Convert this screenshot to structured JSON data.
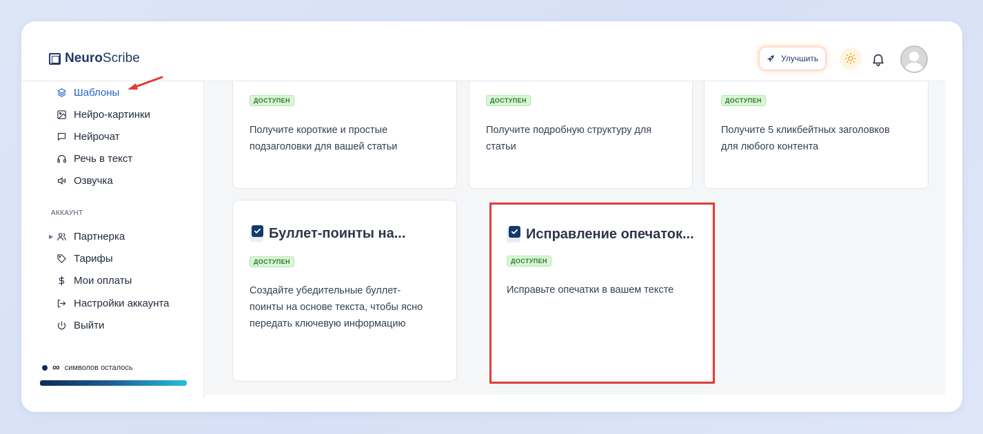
{
  "app": {
    "logo_bold": "Neuro",
    "logo_rest": "Scribe",
    "upgrade_label": "Улучшить"
  },
  "sidebar": {
    "items": [
      {
        "label": "Шаблоны",
        "icon": "layers-icon"
      },
      {
        "label": "Нейро-картинки",
        "icon": "image-icon"
      },
      {
        "label": "Нейрочат",
        "icon": "chat-icon"
      },
      {
        "label": "Речь в текст",
        "icon": "headphones-icon"
      },
      {
        "label": "Озвучка",
        "icon": "speaker-icon"
      }
    ],
    "section_label": "АККАУНТ",
    "account_items": [
      {
        "label": "Партнерка",
        "icon": "users-icon"
      },
      {
        "label": "Тарифы",
        "icon": "tag-icon"
      },
      {
        "label": "Мои оплаты",
        "icon": "dollar-icon"
      },
      {
        "label": "Настройки аккаунта",
        "icon": "login-icon"
      },
      {
        "label": "Выйти",
        "icon": "power-icon"
      }
    ],
    "credits_symbol": "∞",
    "credits_text": "символов осталось"
  },
  "cards": [
    {
      "badge": "ДОСТУПЕН",
      "desc": "Получите короткие и простые подзаголовки для вашей статьи"
    },
    {
      "badge": "ДОСТУПЕН",
      "desc": "Получите подробную структуру для статьи"
    },
    {
      "badge": "ДОСТУПЕН",
      "desc": "Получите 5 кликбейтных заголовков для любого контента"
    },
    {
      "title": "Буллет-поинты на...",
      "badge": "ДОСТУПЕН",
      "desc": "Создайте убедительные буллет-поинты на основе текста, чтобы ясно передать ключевую информацию"
    },
    {
      "title": "Исправление опечаток...",
      "badge": "ДОСТУПЕН",
      "desc": "Исправьте опечатки в вашем тексте"
    }
  ],
  "colors": {
    "accent": "#2563c9",
    "brand_dark": "#1f3a68",
    "badge_green": "#d8f5d4",
    "highlight_red": "#e23b3b"
  }
}
